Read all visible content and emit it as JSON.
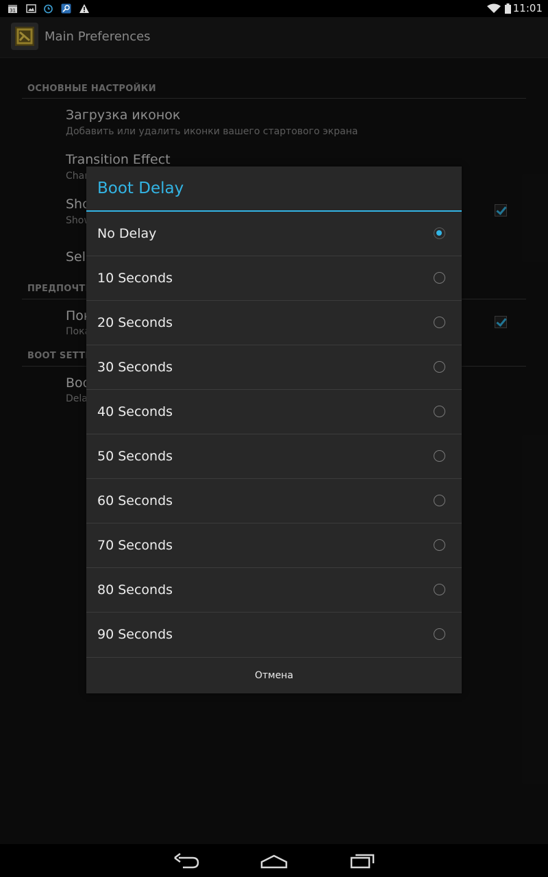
{
  "status_bar": {
    "time": "11:01",
    "icons": [
      "calendar-icon",
      "gallery-icon",
      "alarm-icon",
      "search-app-icon",
      "warning-icon",
      "wifi-icon",
      "battery-icon"
    ]
  },
  "action_bar": {
    "title": "Main Preferences",
    "app_icon": "app-logo-icon"
  },
  "preferences": {
    "category_1": "ОСНОВНЫЕ НАСТРОЙКИ",
    "items": [
      {
        "title": "Загрузка иконок",
        "summary": "Добавить или удалить иконки вашего стартового экрана"
      },
      {
        "title": "Transition Effect",
        "summary": "Chan"
      },
      {
        "title": "Sho",
        "summary": "Show",
        "checked": true
      },
      {
        "title": "Sele",
        "summary": ""
      }
    ],
    "category_2": "ПРЕДПОЧТЕ",
    "items_2": [
      {
        "title": "Пок",
        "summary": "Пока",
        "checked": true
      }
    ],
    "category_3": "BOOT SETTI",
    "items_3": [
      {
        "title": "Boo",
        "summary": "Dela"
      }
    ]
  },
  "dialog": {
    "title": "Boot Delay",
    "options": [
      {
        "label": "No Delay",
        "selected": true
      },
      {
        "label": "10 Seconds",
        "selected": false
      },
      {
        "label": "20 Seconds",
        "selected": false
      },
      {
        "label": "30 Seconds",
        "selected": false
      },
      {
        "label": "40 Seconds",
        "selected": false
      },
      {
        "label": "50 Seconds",
        "selected": false
      },
      {
        "label": "60 Seconds",
        "selected": false
      },
      {
        "label": "70 Seconds",
        "selected": false
      },
      {
        "label": "80 Seconds",
        "selected": false
      },
      {
        "label": "90 Seconds",
        "selected": false
      }
    ],
    "cancel_label": "Отмена"
  },
  "nav_bar": {
    "buttons": [
      "back-icon",
      "home-icon",
      "recent-apps-icon"
    ]
  },
  "colors": {
    "accent": "#33b5e5",
    "dialog_bg": "#282828",
    "background": "#121212"
  }
}
